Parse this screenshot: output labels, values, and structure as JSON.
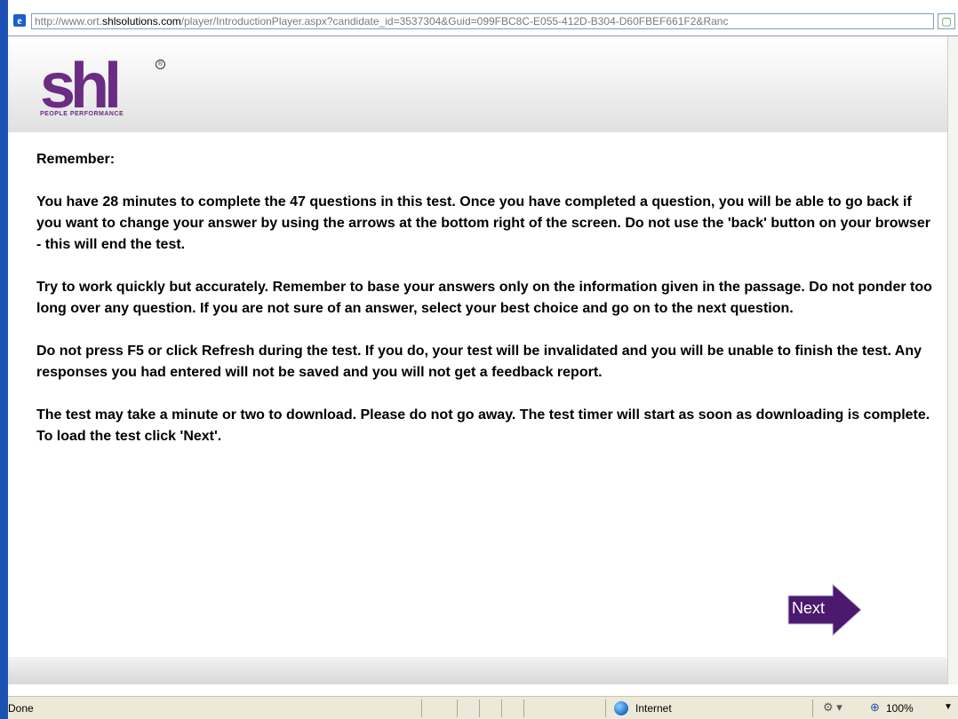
{
  "browser": {
    "url_prefix": "http://www.ort.",
    "url_domain": "shlsolutions.com",
    "url_rest": "/player/IntroductionPlayer.aspx?candidate_id=3537304&Guid=099FBC8C-E055-412D-B304-D60FBEF661F2&Ranc"
  },
  "logo": {
    "text": "shl",
    "subtitle": "PEOPLE PERFORMANCE",
    "registered": "®"
  },
  "content": {
    "heading": "Remember:",
    "paragraphs": [
      "You have 28 minutes to complete the 47 questions in this test. Once you have completed a question, you will be able to go back if you want to change your answer by using the arrows at the bottom right of the screen. Do not use the 'back' button on your browser - this will end the test.",
      "Try to work quickly but accurately. Remember to base your answers only on the information given in the passage. Do not ponder too long over any question. If you are not sure of an answer, select your best choice and go on to the next question.",
      "Do not press F5 or click Refresh during the test. If you do, your test will be invalidated and you will be unable to finish the test. Any responses you had entered will not be saved and you will not get a feedback report.",
      "The test may take a minute or two to download. Please do not go away. The test timer will start as soon as downloading is complete. To load the test click 'Next'."
    ]
  },
  "next_button": {
    "label": "Next",
    "color": "#4b1a6e"
  },
  "status_bar": {
    "status": "Done",
    "zone": "Internet",
    "zoom": "100%"
  },
  "icons": [
    "ie-page-icon",
    "internet-globe-icon",
    "protected-mode-icon",
    "zoom-icon",
    "next-arrow-icon"
  ]
}
